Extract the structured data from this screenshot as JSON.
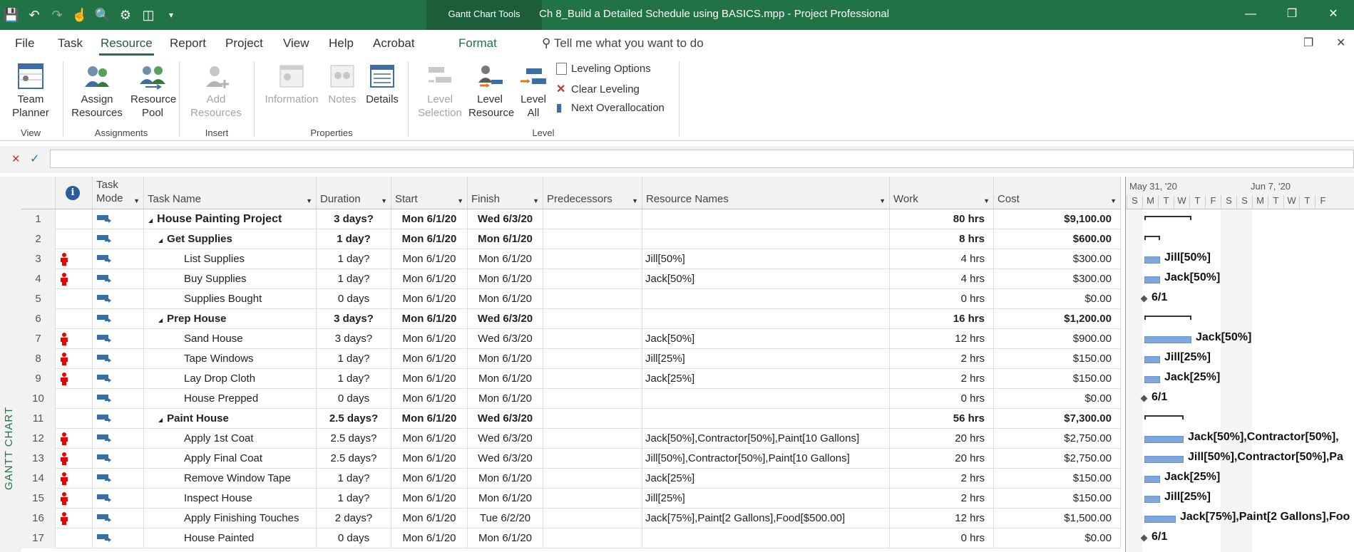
{
  "titlebar": {
    "context_tab": "Gantt Chart Tools",
    "document_title": "Ch 8_Build a Detailed Schedule using BASICS.mpp  -  Project Professional"
  },
  "menu": {
    "tabs": [
      "File",
      "Task",
      "Resource",
      "Report",
      "Project",
      "View",
      "Help",
      "Acrobat"
    ],
    "active": "Resource",
    "format_tab": "Format",
    "tell_me": "Tell me what you want to do"
  },
  "ribbon": {
    "team_planner": "Team Planner",
    "assign_resources": "Assign Resources",
    "resource_pool": "Resource Pool",
    "add_resources": "Add Resources",
    "information": "Information",
    "notes": "Notes",
    "details": "Details",
    "level_selection": "Level Selection",
    "level_resource": "Level Resource",
    "level_all": "Level All",
    "leveling_options": "Leveling Options",
    "clear_leveling": "Clear Leveling",
    "next_overallocation": "Next Overallocation",
    "groups": {
      "view": "View",
      "assignments": "Assignments",
      "insert": "Insert",
      "properties": "Properties",
      "level": "Level"
    }
  },
  "side_label": "GANTT CHART",
  "columns": {
    "task_mode": "Task Mode",
    "task_name": "Task Name",
    "duration": "Duration",
    "start": "Start",
    "finish": "Finish",
    "predecessors": "Predecessors",
    "resource_names": "Resource Names",
    "work": "Work",
    "cost": "Cost"
  },
  "rows": [
    {
      "id": "1",
      "indicator": false,
      "name": "House Painting Project",
      "level": 0,
      "summary": true,
      "duration": "3 days?",
      "start": "Mon 6/1/20",
      "finish": "Wed 6/3/20",
      "pred": "",
      "resources": "",
      "work": "80 hrs",
      "cost": "$9,100.00"
    },
    {
      "id": "2",
      "indicator": false,
      "name": "Get Supplies",
      "level": 1,
      "summary": true,
      "duration": "1 day?",
      "start": "Mon 6/1/20",
      "finish": "Mon 6/1/20",
      "pred": "",
      "resources": "",
      "work": "8 hrs",
      "cost": "$600.00"
    },
    {
      "id": "3",
      "indicator": true,
      "name": "List Supplies",
      "level": 2,
      "summary": false,
      "duration": "1 day?",
      "start": "Mon 6/1/20",
      "finish": "Mon 6/1/20",
      "pred": "",
      "resources": "Jill[50%]",
      "work": "4 hrs",
      "cost": "$300.00"
    },
    {
      "id": "4",
      "indicator": true,
      "name": "Buy Supplies",
      "level": 2,
      "summary": false,
      "duration": "1 day?",
      "start": "Mon 6/1/20",
      "finish": "Mon 6/1/20",
      "pred": "",
      "resources": "Jack[50%]",
      "work": "4 hrs",
      "cost": "$300.00"
    },
    {
      "id": "5",
      "indicator": false,
      "name": "Supplies Bought",
      "level": 2,
      "summary": false,
      "duration": "0 days",
      "start": "Mon 6/1/20",
      "finish": "Mon 6/1/20",
      "pred": "",
      "resources": "",
      "work": "0 hrs",
      "cost": "$0.00"
    },
    {
      "id": "6",
      "indicator": false,
      "name": "Prep House",
      "level": 1,
      "summary": true,
      "duration": "3 days?",
      "start": "Mon 6/1/20",
      "finish": "Wed 6/3/20",
      "pred": "",
      "resources": "",
      "work": "16 hrs",
      "cost": "$1,200.00"
    },
    {
      "id": "7",
      "indicator": true,
      "name": "Sand House",
      "level": 2,
      "summary": false,
      "duration": "3 days?",
      "start": "Mon 6/1/20",
      "finish": "Wed 6/3/20",
      "pred": "",
      "resources": "Jack[50%]",
      "work": "12 hrs",
      "cost": "$900.00"
    },
    {
      "id": "8",
      "indicator": true,
      "name": "Tape Windows",
      "level": 2,
      "summary": false,
      "duration": "1 day?",
      "start": "Mon 6/1/20",
      "finish": "Mon 6/1/20",
      "pred": "",
      "resources": "Jill[25%]",
      "work": "2 hrs",
      "cost": "$150.00"
    },
    {
      "id": "9",
      "indicator": true,
      "name": "Lay Drop Cloth",
      "level": 2,
      "summary": false,
      "duration": "1 day?",
      "start": "Mon 6/1/20",
      "finish": "Mon 6/1/20",
      "pred": "",
      "resources": "Jack[25%]",
      "work": "2 hrs",
      "cost": "$150.00"
    },
    {
      "id": "10",
      "indicator": false,
      "name": "House Prepped",
      "level": 2,
      "summary": false,
      "duration": "0 days",
      "start": "Mon 6/1/20",
      "finish": "Mon 6/1/20",
      "pred": "",
      "resources": "",
      "work": "0 hrs",
      "cost": "$0.00"
    },
    {
      "id": "11",
      "indicator": false,
      "name": "Paint House",
      "level": 1,
      "summary": true,
      "duration": "2.5 days?",
      "start": "Mon 6/1/20",
      "finish": "Wed 6/3/20",
      "pred": "",
      "resources": "",
      "work": "56 hrs",
      "cost": "$7,300.00"
    },
    {
      "id": "12",
      "indicator": true,
      "name": "Apply 1st Coat",
      "level": 2,
      "summary": false,
      "duration": "2.5 days?",
      "start": "Mon 6/1/20",
      "finish": "Wed 6/3/20",
      "pred": "",
      "resources": "Jack[50%],Contractor[50%],Paint[10 Gallons]",
      "work": "20 hrs",
      "cost": "$2,750.00"
    },
    {
      "id": "13",
      "indicator": true,
      "name": "Apply Final Coat",
      "level": 2,
      "summary": false,
      "duration": "2.5 days?",
      "start": "Mon 6/1/20",
      "finish": "Wed 6/3/20",
      "pred": "",
      "resources": "Jill[50%],Contractor[50%],Paint[10 Gallons]",
      "work": "20 hrs",
      "cost": "$2,750.00"
    },
    {
      "id": "14",
      "indicator": true,
      "name": "Remove Window Tape",
      "level": 2,
      "summary": false,
      "duration": "1 day?",
      "start": "Mon 6/1/20",
      "finish": "Mon 6/1/20",
      "pred": "",
      "resources": "Jack[25%]",
      "work": "2 hrs",
      "cost": "$150.00"
    },
    {
      "id": "15",
      "indicator": true,
      "name": "Inspect House",
      "level": 2,
      "summary": false,
      "duration": "1 day?",
      "start": "Mon 6/1/20",
      "finish": "Mon 6/1/20",
      "pred": "",
      "resources": "Jill[25%]",
      "work": "2 hrs",
      "cost": "$150.00"
    },
    {
      "id": "16",
      "indicator": true,
      "name": "Apply Finishing Touches",
      "level": 2,
      "summary": false,
      "duration": "2 days?",
      "start": "Mon 6/1/20",
      "finish": "Tue 6/2/20",
      "pred": "",
      "resources": "Jack[75%],Paint[2 Gallons],Food[$500.00]",
      "work": "12 hrs",
      "cost": "$1,500.00"
    },
    {
      "id": "17",
      "indicator": false,
      "name": "House Painted",
      "level": 2,
      "summary": false,
      "duration": "0 days",
      "start": "Mon 6/1/20",
      "finish": "Mon 6/1/20",
      "pred": "",
      "resources": "",
      "work": "0 hrs",
      "cost": "$0.00"
    }
  ],
  "gantt": {
    "week1": "May 31, '20",
    "week2": "Jun 7, '20",
    "days": [
      "S",
      "M",
      "T",
      "W",
      "T",
      "F",
      "S",
      "S",
      "M",
      "T",
      "W",
      "T",
      "F"
    ],
    "bars": [
      {
        "row": 0,
        "type": "summary",
        "days": 3,
        "label": ""
      },
      {
        "row": 1,
        "type": "summary",
        "days": 1,
        "label": ""
      },
      {
        "row": 2,
        "type": "task",
        "days": 1,
        "label": "Jill[50%]"
      },
      {
        "row": 3,
        "type": "task",
        "days": 1,
        "label": "Jack[50%]"
      },
      {
        "row": 4,
        "type": "milestone",
        "days": 0,
        "label": "6/1"
      },
      {
        "row": 5,
        "type": "summary",
        "days": 3,
        "label": ""
      },
      {
        "row": 6,
        "type": "task",
        "days": 3,
        "label": "Jack[50%]"
      },
      {
        "row": 7,
        "type": "task",
        "days": 1,
        "label": "Jill[25%]"
      },
      {
        "row": 8,
        "type": "task",
        "days": 1,
        "label": "Jack[25%]"
      },
      {
        "row": 9,
        "type": "milestone",
        "days": 0,
        "label": "6/1"
      },
      {
        "row": 10,
        "type": "summary",
        "days": 2.5,
        "label": ""
      },
      {
        "row": 11,
        "type": "task",
        "days": 2.5,
        "label": "Jack[50%],Contractor[50%],"
      },
      {
        "row": 12,
        "type": "task",
        "days": 2.5,
        "label": "Jill[50%],Contractor[50%],Pa"
      },
      {
        "row": 13,
        "type": "task",
        "days": 1,
        "label": "Jack[25%]"
      },
      {
        "row": 14,
        "type": "task",
        "days": 1,
        "label": "Jill[25%]"
      },
      {
        "row": 15,
        "type": "task",
        "days": 2,
        "label": "Jack[75%],Paint[2 Gallons],Foo"
      },
      {
        "row": 16,
        "type": "milestone",
        "days": 0,
        "label": "6/1"
      }
    ]
  }
}
